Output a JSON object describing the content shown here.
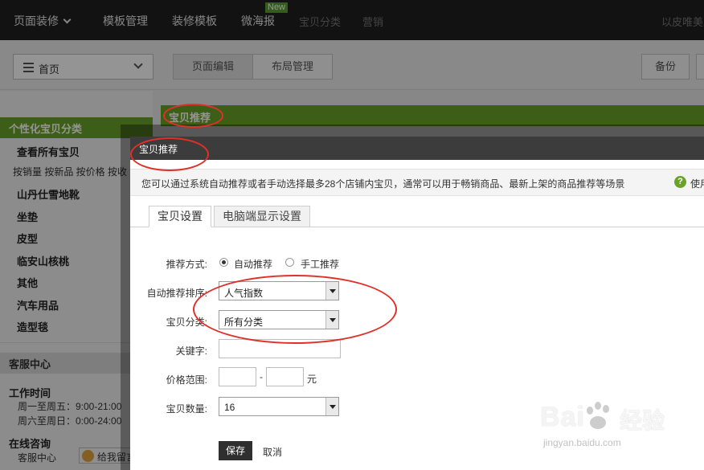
{
  "topnav": {
    "items": [
      "页面装修",
      "模板管理",
      "装修模板",
      "微海报",
      "宝贝分类",
      "营销"
    ],
    "new_badge": "New",
    "right_text": "以皮唯美"
  },
  "subbar": {
    "page_select": "首页",
    "tab_edit": "页面编辑",
    "tab_layout": "布局管理",
    "backup": "备份"
  },
  "sidebar": {
    "category_title": "个性化宝贝分类",
    "view_all": "查看所有宝贝",
    "sort_links": "按销量 按新品 按价格 按收",
    "categories": [
      "山丹仕雪地靴",
      "坐垫",
      "皮型",
      "临安山核桃",
      "其他",
      "汽车用品",
      "造型毯"
    ],
    "service_title": "客服中心",
    "work_time_title": "工作时间",
    "work_time_1": "周一至周五：9:00-21:00",
    "work_time_2": "周六至周日：0:00-24:00",
    "online_title": "在线咨询",
    "online_item": "客服中心",
    "chat_button": "给我留言"
  },
  "content": {
    "module_title": "宝贝推荐"
  },
  "modal": {
    "title": "宝贝推荐",
    "notice": "您可以通过系统自动推荐或者手动选择最多28个店铺内宝贝，通常可以用于畅销商品、最新上架的商品推荐等场景",
    "help_icon_char": "?",
    "help_label": "使用",
    "tabs": [
      "宝贝设置",
      "电脑端显示设置"
    ],
    "form": {
      "method_label": "推荐方式:",
      "method_auto": "自动推荐",
      "method_manual": "手工推荐",
      "sort_label": "自动推荐排序:",
      "sort_value": "人气指数",
      "category_label": "宝贝分类:",
      "category_value": "所有分类",
      "keyword_label": "关键字:",
      "price_label": "价格范围:",
      "price_sep": "-",
      "price_unit": "元",
      "count_label": "宝贝数量:",
      "count_value": "16"
    },
    "save": "保存",
    "cancel": "取消"
  },
  "watermark": {
    "main": "Bai",
    "cn": "经验",
    "sub": "jingyan.baidu.com"
  },
  "colors": {
    "accent_green": "#6aa328",
    "annotation_red": "#e0302a",
    "topbar": "#1f1f1f"
  }
}
